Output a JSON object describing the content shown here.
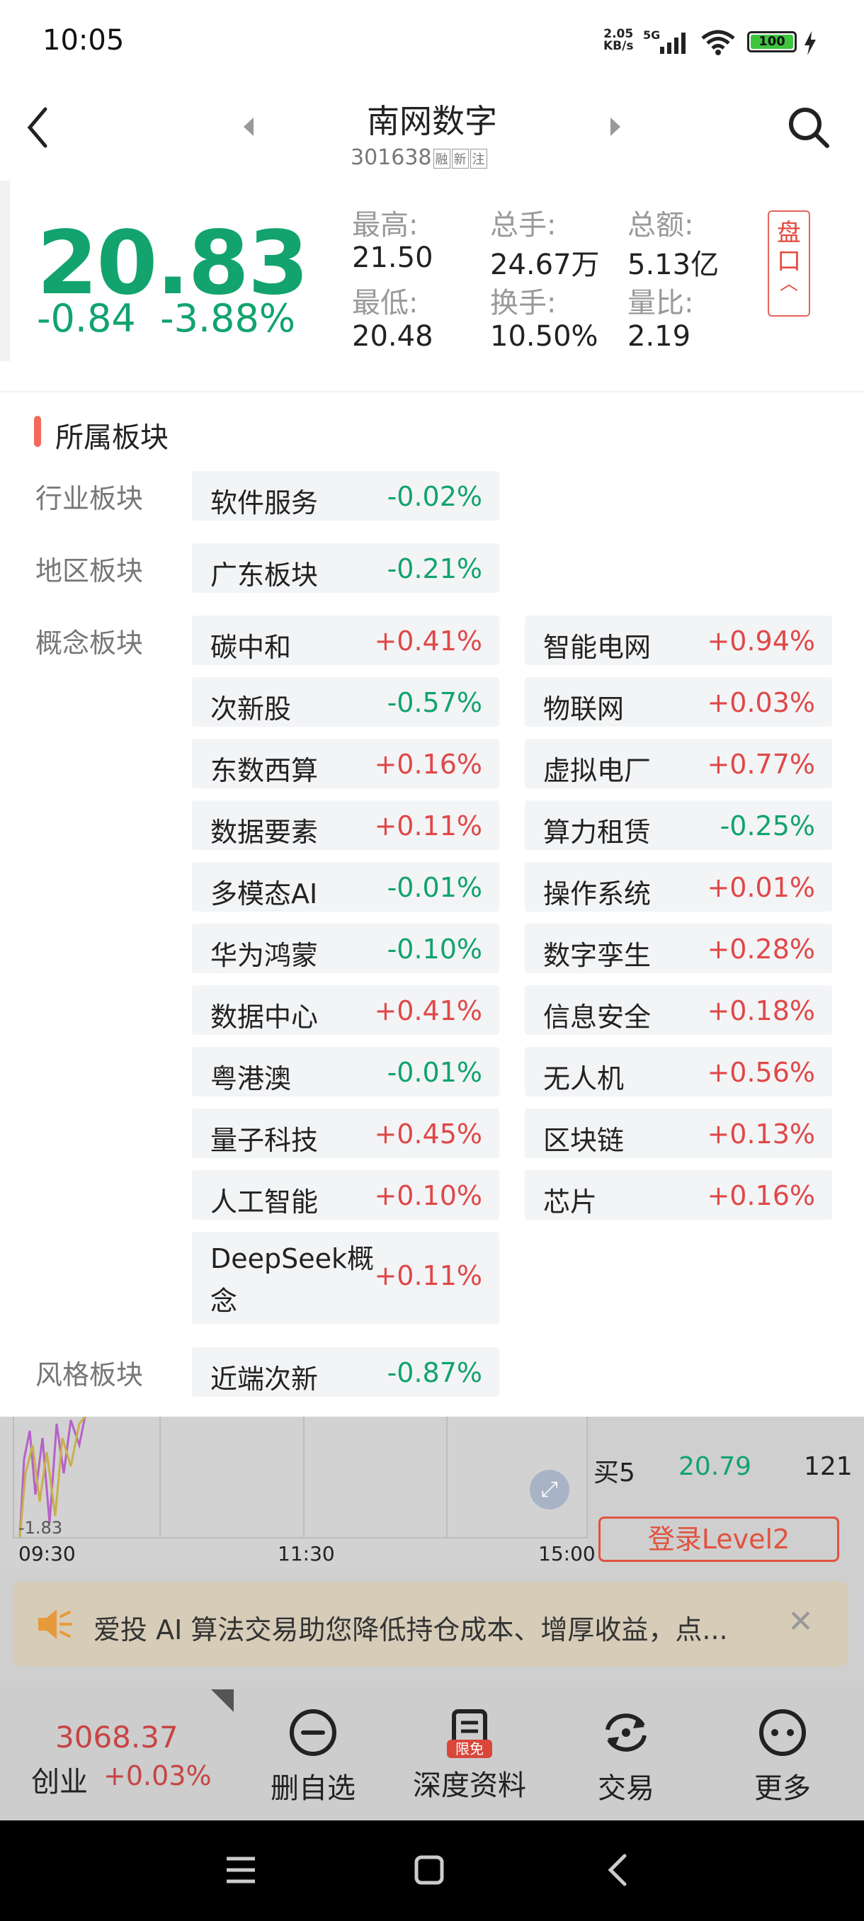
{
  "status": {
    "time": "10:05",
    "net_speed_top": "2.05",
    "net_speed_bottom": "KB/s",
    "network": "5G",
    "battery": "100"
  },
  "header": {
    "name": "南网数字",
    "code": "301638",
    "tags": [
      "融",
      "新",
      "注"
    ]
  },
  "quote": {
    "price": "20.83",
    "change": "-0.84",
    "change_pct": "-3.88%",
    "high_label": "最高:",
    "high": "21.50",
    "low_label": "最低:",
    "low": "20.48",
    "vol_label": "总手:",
    "vol": "24.67万",
    "turnover_label": "换手:",
    "turnover": "10.50%",
    "amount_label": "总额:",
    "amount": "5.13亿",
    "ratio_label": "量比:",
    "ratio": "2.19",
    "pankou": "盘口"
  },
  "sectors": {
    "title": "所属板块",
    "industry_label": "行业板块",
    "industry": [
      {
        "name": "软件服务",
        "pct": "-0.02%"
      }
    ],
    "region_label": "地区板块",
    "region": [
      {
        "name": "广东板块",
        "pct": "-0.21%"
      }
    ],
    "concept_label": "概念板块",
    "concept": [
      {
        "name": "碳中和",
        "pct": "+0.41%"
      },
      {
        "name": "智能电网",
        "pct": "+0.94%"
      },
      {
        "name": "次新股",
        "pct": "-0.57%"
      },
      {
        "name": "物联网",
        "pct": "+0.03%"
      },
      {
        "name": "东数西算",
        "pct": "+0.16%"
      },
      {
        "name": "虚拟电厂",
        "pct": "+0.77%"
      },
      {
        "name": "数据要素",
        "pct": "+0.11%"
      },
      {
        "name": "算力租赁",
        "pct": "-0.25%"
      },
      {
        "name": "多模态AI",
        "pct": "-0.01%"
      },
      {
        "name": "操作系统",
        "pct": "+0.01%"
      },
      {
        "name": "华为鸿蒙",
        "pct": "-0.10%"
      },
      {
        "name": "数字孪生",
        "pct": "+0.28%"
      },
      {
        "name": "数据中心",
        "pct": "+0.41%"
      },
      {
        "name": "信息安全",
        "pct": "+0.18%"
      },
      {
        "name": "粤港澳",
        "pct": "-0.01%"
      },
      {
        "name": "无人机",
        "pct": "+0.56%"
      },
      {
        "name": "量子科技",
        "pct": "+0.45%"
      },
      {
        "name": "区块链",
        "pct": "+0.13%"
      },
      {
        "name": "人工智能",
        "pct": "+0.10%"
      },
      {
        "name": "芯片",
        "pct": "+0.16%"
      },
      {
        "name": "DeepSeek概念",
        "pct": "+0.11%"
      }
    ],
    "style_label": "风格板块",
    "style": [
      {
        "name": "近端次新",
        "pct": "-0.87%"
      }
    ]
  },
  "chart": {
    "y_label": "-1.83",
    "times": [
      "09:30",
      "11:30",
      "15:00"
    ]
  },
  "orderbook": {
    "buy5_label": "买5",
    "buy5_price": "20.79",
    "buy5_vol": "121",
    "level2_label": "登录Level2"
  },
  "ad": {
    "text": "爱投 AI 算法交易助您降低持仓成本、增厚收益，点..."
  },
  "toolbar": {
    "index_value": "3068.37",
    "index_name": "创业",
    "index_change": "+0.03%",
    "items": [
      {
        "label": "删自选",
        "icon": "minus-circle-icon"
      },
      {
        "label": "深度资料",
        "icon": "document-icon",
        "badge": "限免"
      },
      {
        "label": "交易",
        "icon": "refresh-icon"
      },
      {
        "label": "更多",
        "icon": "more-icon"
      }
    ]
  },
  "colors": {
    "up": "#e04848",
    "down": "#12a36e",
    "accent": "#e0533f"
  }
}
